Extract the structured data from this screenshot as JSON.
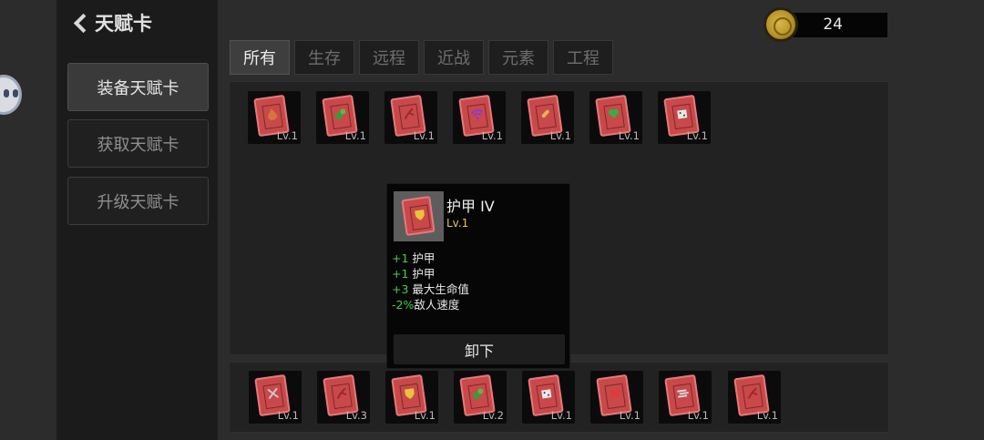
{
  "header": {
    "title": "天赋卡"
  },
  "side_menu": [
    {
      "label": "装备天赋卡",
      "active": true
    },
    {
      "label": "获取天赋卡",
      "active": false
    },
    {
      "label": "升级天赋卡",
      "active": false
    }
  ],
  "currency": {
    "icon": "coin-icon",
    "amount": "24"
  },
  "tabs": [
    {
      "label": "所有",
      "active": true
    },
    {
      "label": "生存",
      "active": false
    },
    {
      "label": "远程",
      "active": false
    },
    {
      "label": "近战",
      "active": false
    },
    {
      "label": "元素",
      "active": false
    },
    {
      "label": "工程",
      "active": false
    }
  ],
  "inventory_cards": [
    {
      "icon": "drop-icon",
      "level": "Lv.1"
    },
    {
      "icon": "plant-icon",
      "level": "Lv.1"
    },
    {
      "icon": "branch-icon",
      "level": "Lv.1"
    },
    {
      "icon": "wifi-icon",
      "level": "Lv.1"
    },
    {
      "icon": "bullet-icon",
      "level": "Lv.1"
    },
    {
      "icon": "heart-icon",
      "level": "Lv.1"
    },
    {
      "icon": "dice-icon",
      "level": "Lv.1"
    }
  ],
  "equipped_cards": [
    {
      "icon": "cross-swords-icon",
      "level": "Lv.1"
    },
    {
      "icon": "branch-icon",
      "level": "Lv.3"
    },
    {
      "icon": "shield-icon",
      "level": "Lv.1"
    },
    {
      "icon": "plant-icon",
      "level": "Lv.2"
    },
    {
      "icon": "dice-icon",
      "level": "Lv.1"
    },
    {
      "icon": "x-icon",
      "level": "Lv.1"
    },
    {
      "icon": "speed-icon",
      "level": "Lv.1"
    },
    {
      "icon": "branch-icon",
      "level": "Lv.1"
    }
  ],
  "tooltip": {
    "icon": "shield-icon",
    "title": "护甲 IV",
    "level": "Lv.1",
    "stats": [
      {
        "value": "+1",
        "text": "护甲"
      },
      {
        "value": "+1",
        "text": "护甲"
      },
      {
        "value": "+3",
        "text": "最大生命值"
      },
      {
        "value": "-2%",
        "text": "敌人速度"
      }
    ],
    "button_label": "卸下"
  },
  "colors": {
    "card_red": "#c9484a",
    "stat_green": "#4ec94e",
    "level_gold": "#e0c94b"
  }
}
